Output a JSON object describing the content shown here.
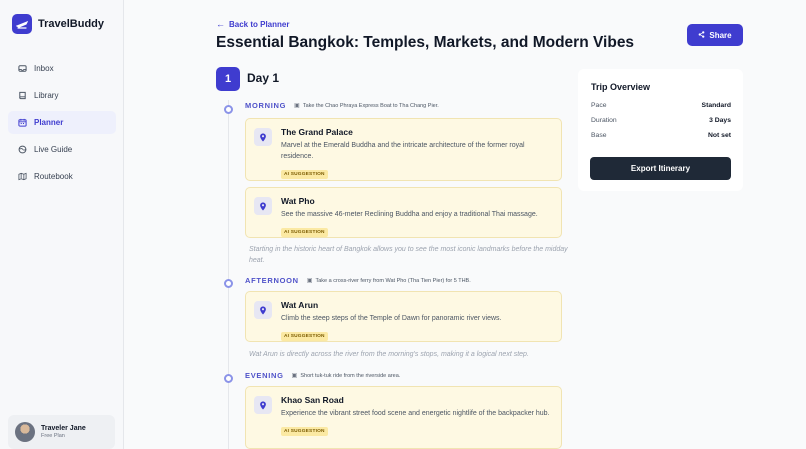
{
  "app": {
    "name": "TravelBuddy"
  },
  "sidebar": {
    "items": [
      {
        "label": "Inbox",
        "icon": "inbox-icon"
      },
      {
        "label": "Library",
        "icon": "book-icon"
      },
      {
        "label": "Planner",
        "icon": "calendar-icon",
        "active": true
      },
      {
        "label": "Live Guide",
        "icon": "globe-icon"
      },
      {
        "label": "Routebook",
        "icon": "map-icon"
      }
    ]
  },
  "user": {
    "name": "Traveler Jane",
    "plan": "Free Plan"
  },
  "header": {
    "back_label": "Back to Planner",
    "title": "Essential Bangkok: Temples, Markets, and Modern Vibes",
    "share_label": "Share"
  },
  "day": {
    "number": "1",
    "title": "Day 1"
  },
  "periods": [
    {
      "label": "MORNING",
      "transit": "Take the Chao Phraya Express Boat to Tha Chang Pier."
    },
    {
      "label": "AFTERNOON",
      "transit": "Take a cross-river ferry from Wat Pho (Tha Tien Pier) for 5 THB."
    },
    {
      "label": "EVENING",
      "transit": "Short tuk-tuk ride from the riverside area."
    }
  ],
  "cards": [
    {
      "title": "The Grand Palace",
      "desc": "Marvel at the Emerald Buddha and the intricate architecture of the former royal residence.",
      "tag": "AI SUGGESTION"
    },
    {
      "title": "Wat Pho",
      "desc": "See the massive 46-meter Reclining Buddha and enjoy a traditional Thai massage.",
      "tag": "AI SUGGESTION"
    },
    {
      "title": "Wat Arun",
      "desc": "Climb the steep steps of the Temple of Dawn for panoramic river views.",
      "tag": "AI SUGGESTION"
    },
    {
      "title": "Khao San Road",
      "desc": "Experience the vibrant street food scene and energetic nightlife of the backpacker hub.",
      "tag": "AI SUGGESTION"
    }
  ],
  "notes": [
    "Starting in the historic heart of Bangkok allows you to see the most iconic landmarks before the midday heat.",
    "Wat Arun is directly across the river from the morning's stops, making it a logical next step."
  ],
  "overview": {
    "title": "Trip Overview",
    "rows": [
      {
        "key": "Pace",
        "value": "Standard"
      },
      {
        "key": "Duration",
        "value": "3 Days"
      },
      {
        "key": "Base",
        "value": "Not set"
      }
    ],
    "export_label": "Export Itinerary"
  },
  "colors": {
    "accent": "#3f3ccf",
    "card_bg": "#fef9e3",
    "dark_button": "#1f2937"
  }
}
